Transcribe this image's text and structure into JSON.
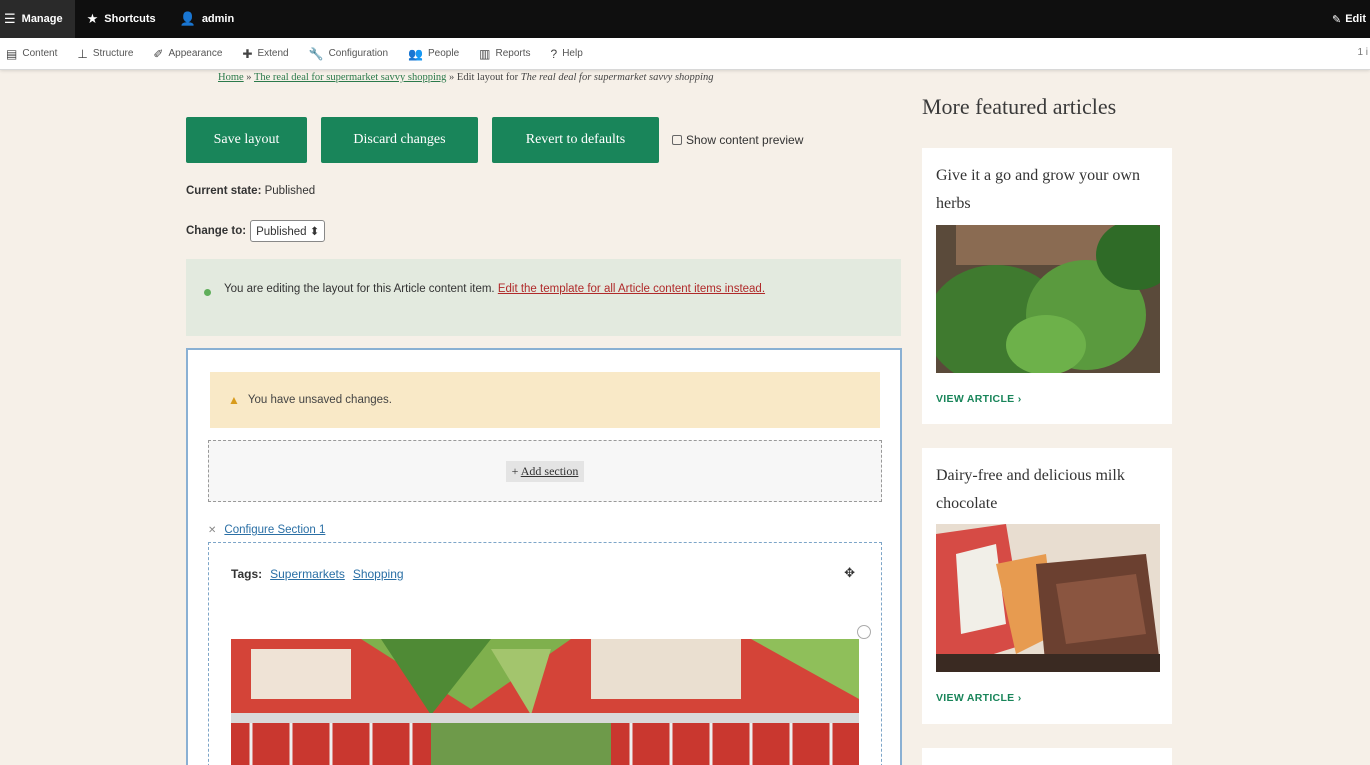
{
  "toolbar": {
    "manage": "Manage",
    "shortcuts": "Shortcuts",
    "user": "admin",
    "edit": "Edit"
  },
  "menu": {
    "items": [
      "Content",
      "Structure",
      "Appearance",
      "Extend",
      "Configuration",
      "People",
      "Reports",
      "Help"
    ],
    "right": "1 i"
  },
  "breadcrumb": {
    "home": "Home",
    "sep": " » ",
    "article_link": "The real deal for supermarket savvy shopping",
    "current_prefix": "Edit layout for ",
    "current_title": "The real deal for supermarket savvy shopping"
  },
  "actions": {
    "save": "Save layout",
    "discard": "Discard changes",
    "revert": "Revert to defaults",
    "preview": "Show content preview"
  },
  "state": {
    "label": "Current state:",
    "value": "Published",
    "change_label": "Change to:",
    "change_value": "Published"
  },
  "info_message": {
    "text": "You are editing the layout for this Article content item.",
    "link": "Edit the template for all Article content items instead."
  },
  "warning": "You have unsaved changes.",
  "add_section": "Add section",
  "configure_section": "Configure Section 1",
  "tags": {
    "label": "Tags:",
    "items": [
      "Supermarkets",
      "Shopping"
    ]
  },
  "sidebar": {
    "title": "More featured articles",
    "cards": [
      {
        "title": "Give it a go and grow your own herbs",
        "link": "VIEW ARTICLE"
      },
      {
        "title": "Dairy-free and delicious milk chocolate",
        "link": "VIEW ARTICLE"
      }
    ]
  },
  "colors": {
    "primary_green": "#19855a",
    "background": "#f6f0e8",
    "warning": "#f9e9c7",
    "info": "#e3eadf"
  }
}
